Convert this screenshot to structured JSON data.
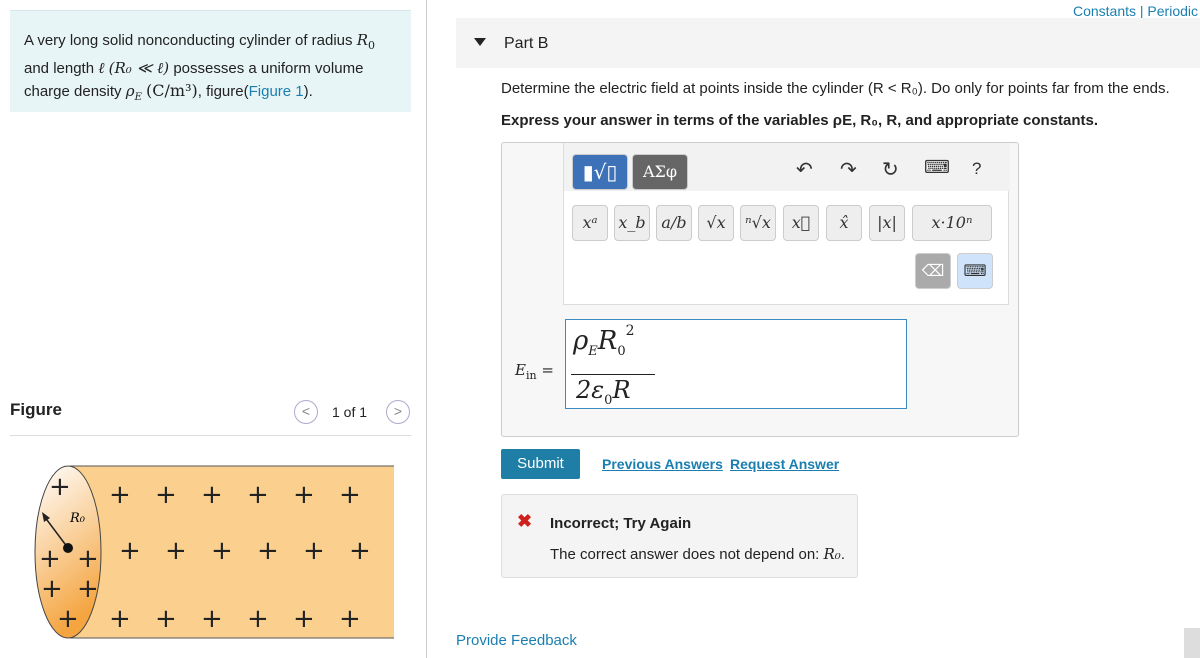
{
  "problem": {
    "text_1": "A very long solid nonconducting cylinder of radius ",
    "r0": "R",
    "r0_sub": "0",
    "text_2": "and length ",
    "ell": "ℓ",
    "cond": "(R₀ ≪ ℓ)",
    "text_3": " possesses a uniform volume",
    "text_4": "charge density ",
    "rho": "ρ",
    "rho_sub": "E",
    "units": "(C/m³)",
    "text_5": ", figure(",
    "figure_link": "Figure 1",
    "text_6": ")."
  },
  "figure": {
    "title": "Figure",
    "count": "1 of 1",
    "prev": "<",
    "next": ">",
    "radius_label": "R₀"
  },
  "header": {
    "constants": "Constants | Periodic"
  },
  "part": {
    "label": "Part B"
  },
  "question": {
    "text": "Determine the electric field at points inside the cylinder (R < R₀). Do only for points far from the ends.",
    "express": "Express your answer in terms of the variables ρE, R₀, R, and appropriate constants."
  },
  "toolbar": {
    "templates": "▮√▯",
    "greek": "ΑΣφ",
    "undo": "↶",
    "redo": "↷",
    "reset": "↻",
    "keyboard": "⌨",
    "help": "?",
    "buttons": [
      "xᵃ",
      "x_b",
      "a/b",
      "√x",
      "ⁿ√x",
      "x⃗",
      "x̂",
      "|x|",
      "x·10ⁿ"
    ]
  },
  "answer": {
    "label": "E",
    "label_sub": "in",
    "eq": "=",
    "numerator": "ρ_E R_0²",
    "num_rho": "ρ",
    "num_E": "E",
    "num_R": "R",
    "num_0": "0",
    "num_2": "2",
    "den_2": "2ε",
    "den_0": "0",
    "den_R": "R"
  },
  "actions": {
    "submit": "Submit",
    "previous": "Previous Answers",
    "request": "Request Answer"
  },
  "feedback": {
    "icon": "✖",
    "title": "Incorrect; Try Again",
    "message": "The correct answer does not depend on: ",
    "var": "R₀",
    "end": "."
  },
  "footer": {
    "provide": "Provide Feedback"
  },
  "colors": {
    "accent": "#1e7ea6",
    "problem_bg": "#e8f5f6",
    "error": "#d0201c",
    "cylinder": "#fbd08e"
  }
}
